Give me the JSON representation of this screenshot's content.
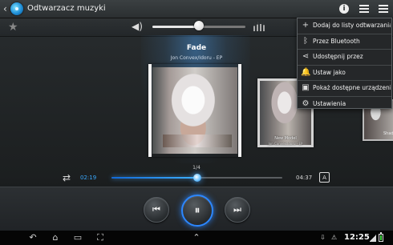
{
  "app": {
    "back_glyph": "‹",
    "title": "Odtwarzacz muzyki",
    "icons": [
      "music-app-icon",
      "info-icon",
      "playlist-icon",
      "menu-icon"
    ]
  },
  "topbar": {
    "info_glyph": "i",
    "playlist_glyph": "≡",
    "menu_glyph": "☰"
  },
  "toolbar": {
    "favorite_glyph": "★",
    "volume_glyph": "◀)",
    "volume_level": 0.5,
    "equalizer_glyph": "▥"
  },
  "track": {
    "title": "Fade",
    "subtitle": "Jon Convex/Idoru - EP",
    "position": "1/4",
    "current_time": "02:19",
    "duration": "04:37",
    "progress": 0.5
  },
  "albums": {
    "side_title": "New Model",
    "side_subtitle": "Jon Convex/Idoru - EP",
    "right_label": "Shad"
  },
  "menu": {
    "items": [
      {
        "icon": "+",
        "label": "Dodaj do listy odtwarzania",
        "icon_name": "add-to-playlist-icon"
      },
      {
        "icon": "ᛒ",
        "label": "Przez Bluetooth",
        "icon_name": "bluetooth-icon"
      },
      {
        "icon": "⋖",
        "label": "Udostępnij przez",
        "icon_name": "share-icon"
      },
      {
        "icon": "🔔",
        "label": "Ustaw jako",
        "icon_name": "set-as-icon"
      },
      {
        "icon": "▣",
        "label": "Pokaż dostępne urządzenia",
        "icon_name": "devices-icon"
      },
      {
        "icon": "⚙",
        "label": "Ustawienia",
        "icon_name": "settings-icon"
      }
    ]
  },
  "controls": {
    "shuffle_glyph": "⇄",
    "previous_glyph": "⏮",
    "pause_glyph": "⏸",
    "next_glyph": "⏭",
    "repeat_glyph": "A"
  },
  "statusbar": {
    "back_glyph": "↶",
    "home_glyph": "⌂",
    "recent_glyph": "▭",
    "screenshot_glyph": "⛶",
    "up_glyph": "⌃",
    "usb_glyph": "⇩",
    "debug_glyph": "⚠",
    "time": "12:25",
    "battery_level": 0.8
  },
  "colors": {
    "accent_blue": "#39a9ff",
    "menu_background": "#252729",
    "control_glow": "#2c87ff"
  }
}
